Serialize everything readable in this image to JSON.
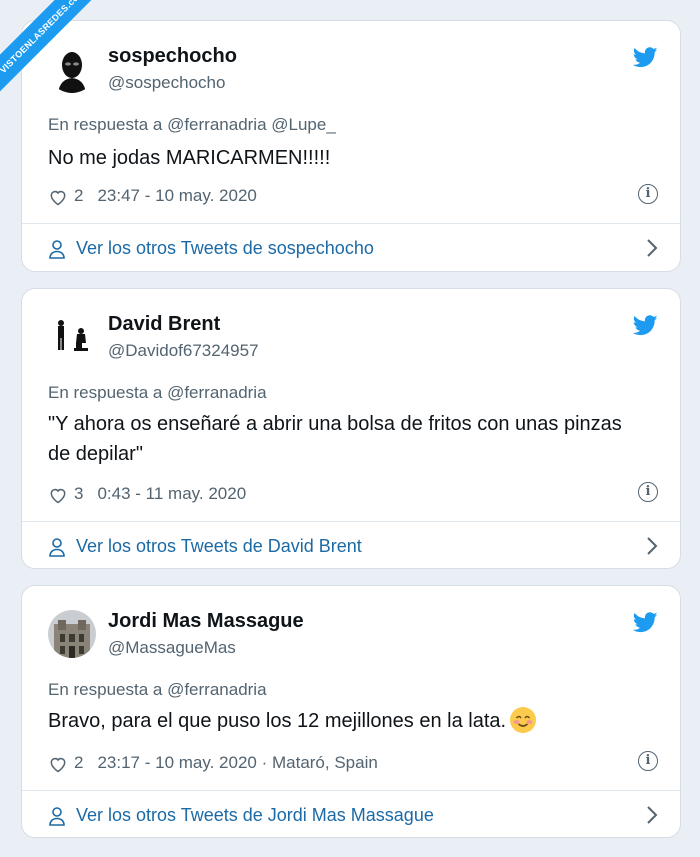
{
  "watermark": "VISTOENLASREDES.com",
  "colors": {
    "twitter_blue": "#1d9bf0",
    "link": "#1b6aa5",
    "muted": "#536471",
    "text": "#0f1419"
  },
  "tweets": [
    {
      "name": "sospechocho",
      "handle": "@sospechocho",
      "reply_to": "En respuesta a @ferranadria @Lupe_",
      "text": "No me jodas MARICARMEN!!!!!",
      "likes": "2",
      "timestamp": "23:47 - 10 may. 2020",
      "more_link": "Ver los otros Tweets de sospechocho"
    },
    {
      "name": "David Brent",
      "handle": "@Davidof67324957",
      "reply_to": "En respuesta a @ferranadria",
      "text": "\"Y ahora os enseñaré a abrir una bolsa de fritos con unas pinzas de depilar\"",
      "likes": "3",
      "timestamp": "0:43 - 11 may. 2020",
      "more_link": "Ver los otros Tweets de David Brent"
    },
    {
      "name": "Jordi Mas Massague",
      "handle": "@MassagueMas",
      "reply_to": "En respuesta a @ferranadria",
      "text": "Bravo, para el que puso los 12 mejillones en la lata.",
      "emoji": "smiling-face-emoji",
      "likes": "2",
      "timestamp": "23:17 - 10 may. 2020 · Mataró, Spain",
      "more_link": "Ver los otros Tweets de Jordi Mas Massague"
    }
  ],
  "icons": [
    "heart-icon",
    "info-icon",
    "twitter-bird-icon",
    "user-icon",
    "chevron-right-icon"
  ]
}
